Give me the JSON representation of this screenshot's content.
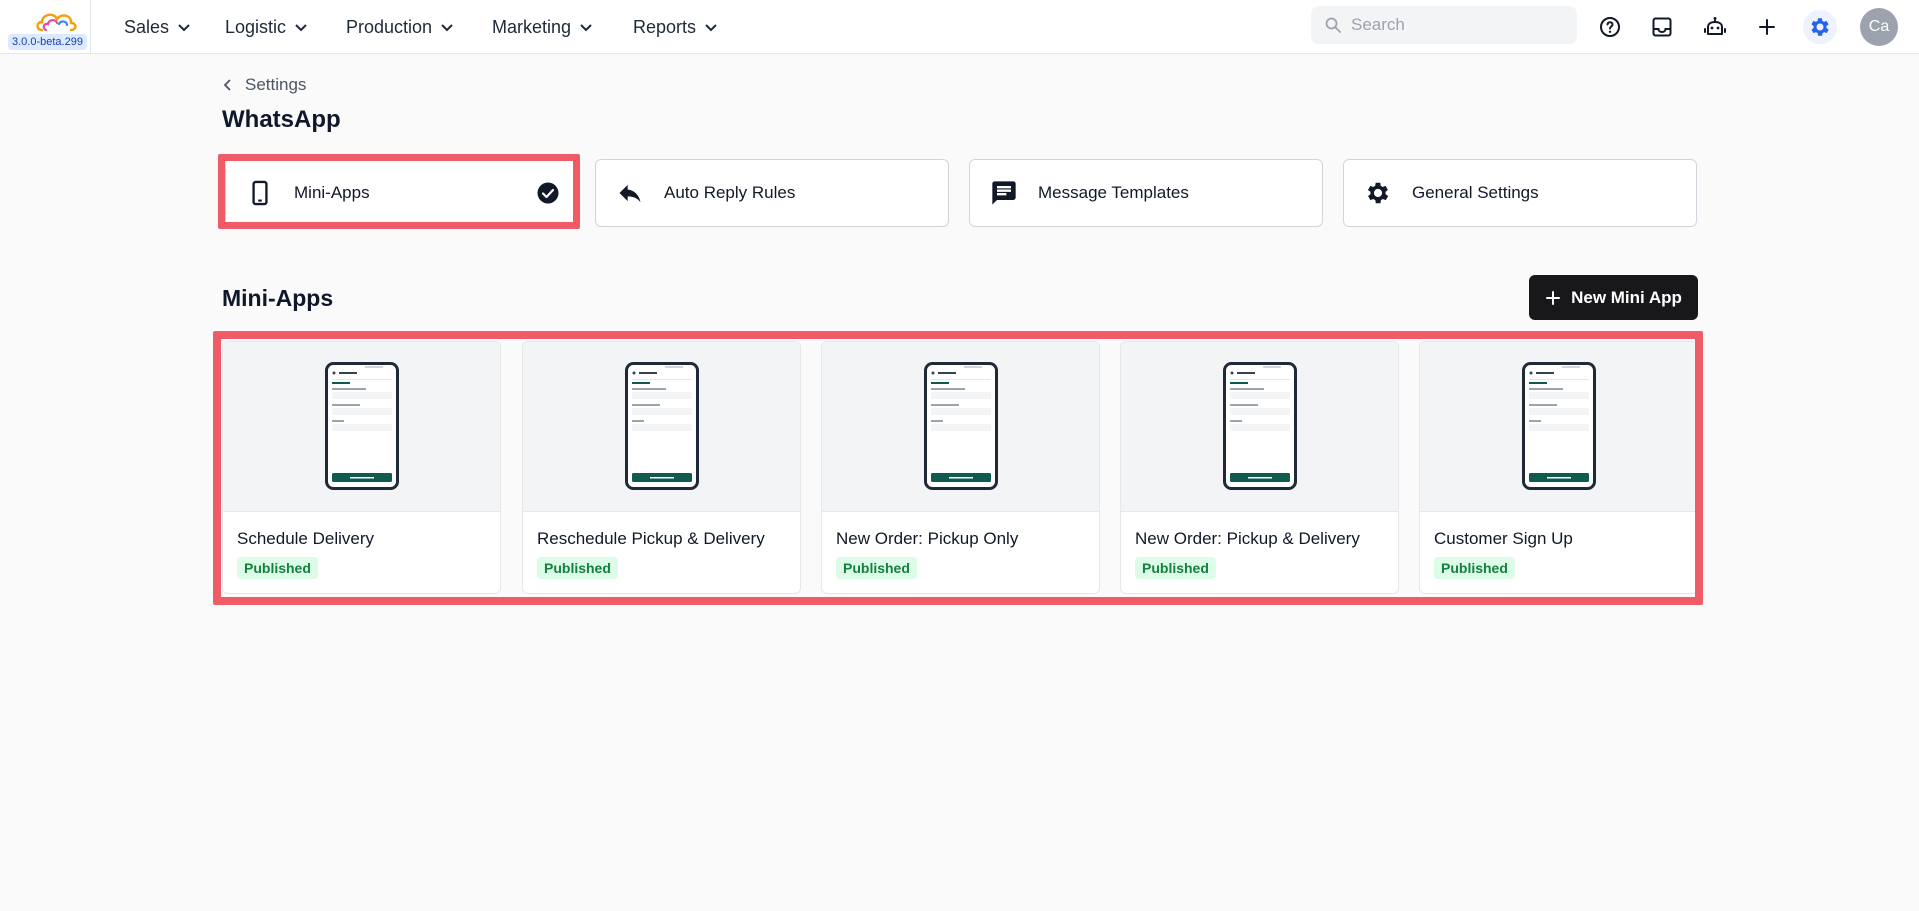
{
  "app": {
    "version": "3.0.0-beta.299"
  },
  "nav": [
    {
      "label": "Sales"
    },
    {
      "label": "Logistic"
    },
    {
      "label": "Production"
    },
    {
      "label": "Marketing"
    },
    {
      "label": "Reports"
    }
  ],
  "search": {
    "placeholder": "Search"
  },
  "topbar_icons": [
    "help-circle-icon",
    "inbox-icon",
    "robot-icon",
    "plus-icon",
    "gear-icon"
  ],
  "user": {
    "initials": "Ca"
  },
  "breadcrumb": {
    "label": "Settings"
  },
  "page": {
    "title": "WhatsApp"
  },
  "tabs": [
    {
      "label": "Mini-Apps",
      "icon": "smartphone-icon",
      "selected": true
    },
    {
      "label": "Auto Reply Rules",
      "icon": "reply-icon",
      "selected": false
    },
    {
      "label": "Message Templates",
      "icon": "message-icon",
      "selected": false
    },
    {
      "label": "General Settings",
      "icon": "gear-icon",
      "selected": false
    }
  ],
  "section": {
    "title": "Mini-Apps",
    "new_button_label": "New Mini App"
  },
  "mini_apps": [
    {
      "name": "Schedule Delivery",
      "status": "Published"
    },
    {
      "name": "Reschedule Pickup & Delivery",
      "status": "Published"
    },
    {
      "name": "New Order: Pickup Only",
      "status": "Published"
    },
    {
      "name": "New Order: Pickup & Delivery",
      "status": "Published"
    },
    {
      "name": "Customer Sign Up",
      "status": "Published"
    }
  ],
  "colors": {
    "highlight": "#ef5b66",
    "accent": "#2563eb",
    "published_bg": "#dcfce7",
    "published_text": "#15803d",
    "phone_bar": "#0f5c4e"
  }
}
